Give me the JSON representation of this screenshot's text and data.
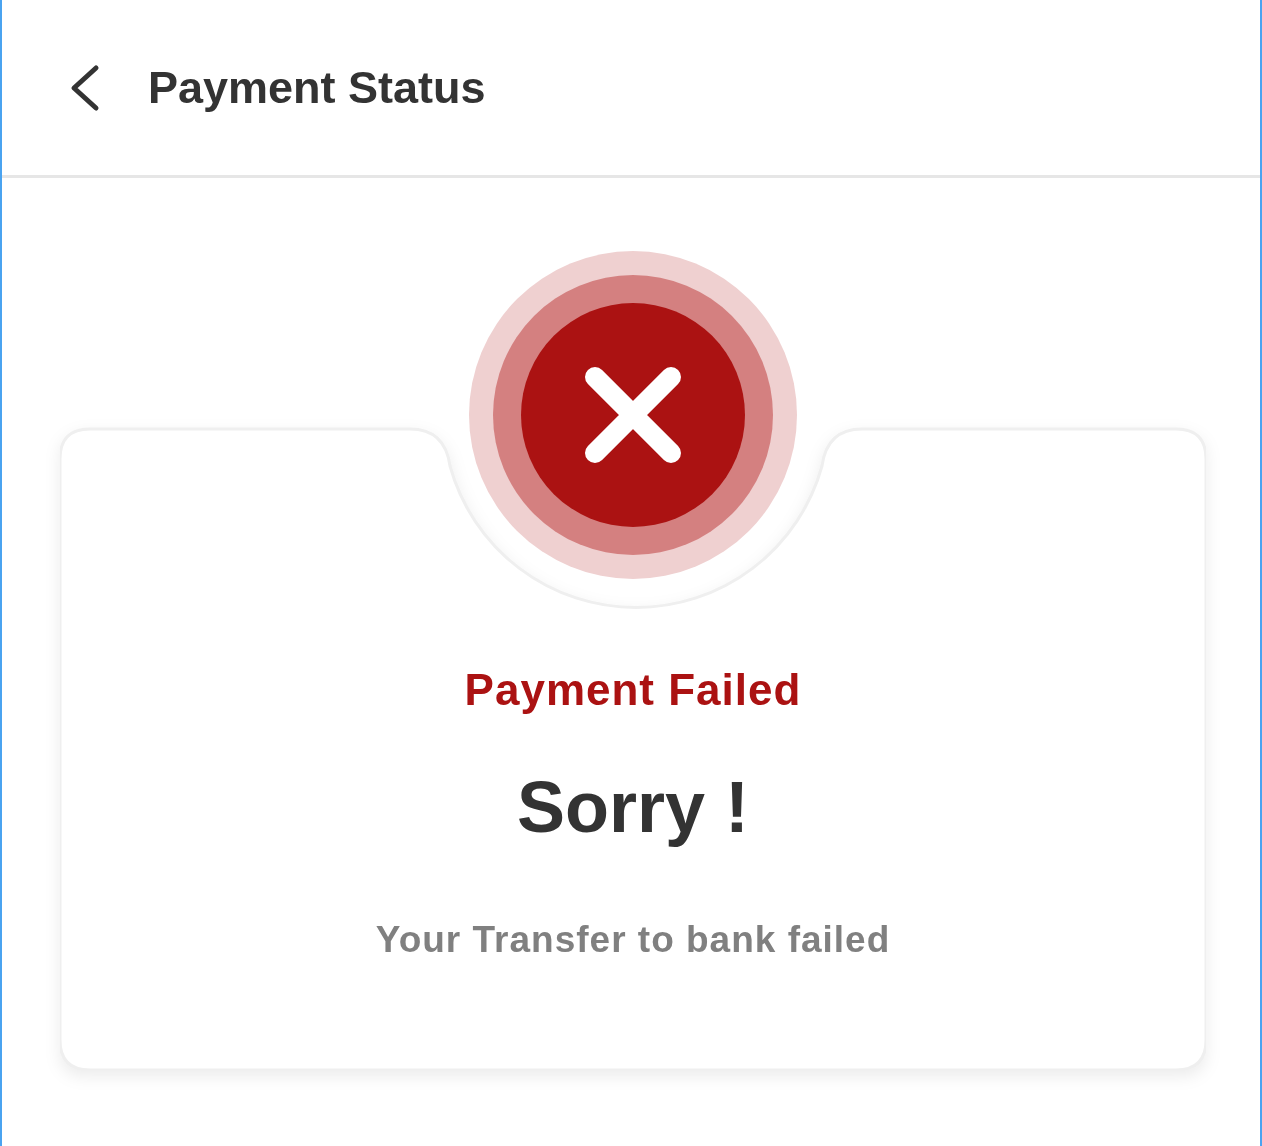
{
  "header": {
    "title": "Payment Status"
  },
  "status": {
    "kind": "failed",
    "title": "Payment Failed",
    "headline": "Sorry !",
    "message": "Your Transfer to bank failed"
  }
}
